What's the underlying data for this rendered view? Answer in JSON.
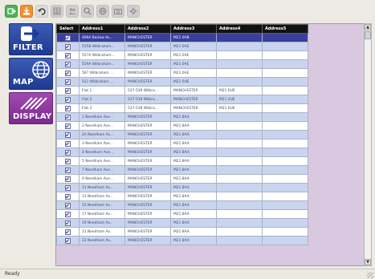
{
  "toolbar": {
    "icons": [
      "export-icon",
      "import-icon",
      "undo-icon",
      "grid-icon",
      "users-icon",
      "search-icon",
      "globe-icon",
      "camera-icon",
      "settings-icon"
    ]
  },
  "nav": {
    "filter_label": "FILTER",
    "map_label": "MAP",
    "display_label": "DISPLAY"
  },
  "grid": {
    "columns": [
      "Select",
      "Address1",
      "Address2",
      "Address3",
      "Address4",
      "Address5"
    ],
    "rows": [
      {
        "address1": "406A Barlow Av...",
        "address2": "MANCHESTER",
        "address3": "M21 0AB",
        "address4": "",
        "address5": "",
        "selected": true
      },
      {
        "address1": "555B Wilbraham...",
        "address2": "MANCHESTER",
        "address3": "M21 0AE",
        "address4": "",
        "address5": ""
      },
      {
        "address1": "557A Wilbraham...",
        "address2": "MANCHESTER",
        "address3": "M21 0AE",
        "address4": "",
        "address5": ""
      },
      {
        "address1": "559A Wilbraham...",
        "address2": "MANCHESTER",
        "address3": "M21 0AE",
        "address4": "",
        "address5": ""
      },
      {
        "address1": "567 Wilbraham ...",
        "address2": "MANCHESTER",
        "address3": "M21 0AE",
        "address4": "",
        "address5": ""
      },
      {
        "address1": "521 Wilbraham ...",
        "address2": "MANCHESTER",
        "address3": "M21 0UE",
        "address4": "",
        "address5": ""
      },
      {
        "address1": "Flat 1",
        "address2": "537-539 Wilbra...",
        "address3": "MANCHESTER",
        "address4": "M21 0UE",
        "address5": ""
      },
      {
        "address1": "Flat 2",
        "address2": "537-539 Wilbra...",
        "address3": "MANCHESTER",
        "address4": "M21 0UE",
        "address5": ""
      },
      {
        "address1": "Flat 3",
        "address2": "537-539 Wilbra...",
        "address3": "MANCHESTER",
        "address4": "M21 0UE",
        "address5": ""
      },
      {
        "address1": "1 Needham Ave...",
        "address2": "MANCHESTER",
        "address3": "M21 8AA",
        "address4": "",
        "address5": ""
      },
      {
        "address1": "2 Needham Ave...",
        "address2": "MANCHESTER",
        "address3": "M21 8AA",
        "address4": "",
        "address5": ""
      },
      {
        "address1": "2A Needham Av...",
        "address2": "MANCHESTER",
        "address3": "M21 8AA",
        "address4": "",
        "address5": ""
      },
      {
        "address1": "3 Needham Ave...",
        "address2": "MANCHESTER",
        "address3": "M21 8AA",
        "address4": "",
        "address5": ""
      },
      {
        "address1": "4 Needham Ave...",
        "address2": "MANCHESTER",
        "address3": "M21 8AA",
        "address4": "",
        "address5": ""
      },
      {
        "address1": "5 Needham Ave...",
        "address2": "MANCHESTER",
        "address3": "M21 8AA",
        "address4": "",
        "address5": ""
      },
      {
        "address1": "7 Needham Ave...",
        "address2": "MANCHESTER",
        "address3": "M21 8AA",
        "address4": "",
        "address5": ""
      },
      {
        "address1": "9 Needham Ave...",
        "address2": "MANCHESTER",
        "address3": "M21 8AA",
        "address4": "",
        "address5": ""
      },
      {
        "address1": "11 Needham Av...",
        "address2": "MANCHESTER",
        "address3": "M21 8AA",
        "address4": "",
        "address5": ""
      },
      {
        "address1": "13 Needham Av...",
        "address2": "MANCHESTER",
        "address3": "M21 8AA",
        "address4": "",
        "address5": ""
      },
      {
        "address1": "15 Needham Av...",
        "address2": "MANCHESTER",
        "address3": "M21 8AA",
        "address4": "",
        "address5": ""
      },
      {
        "address1": "17 Needham Av...",
        "address2": "MANCHESTER",
        "address3": "M21 8AA",
        "address4": "",
        "address5": ""
      },
      {
        "address1": "19 Needham Av...",
        "address2": "MANCHESTER",
        "address3": "M21 8AA",
        "address4": "",
        "address5": ""
      },
      {
        "address1": "21 Needham Av...",
        "address2": "MANCHESTER",
        "address3": "M21 8AA",
        "address4": "",
        "address5": ""
      },
      {
        "address1": "23 Needham Av...",
        "address2": "MANCHESTER",
        "address3": "M21 8AA",
        "address4": "",
        "address5": ""
      }
    ]
  },
  "statusbar": {
    "text": "Ready"
  },
  "colors": {
    "nav_blue": "#2a4aa8",
    "nav_purple": "#8b3aa0",
    "header_black": "#111111",
    "row_alt_blue": "#c9d5ee",
    "selected_row": "#3a3f9c",
    "panel_lilac": "#d9c8df"
  }
}
